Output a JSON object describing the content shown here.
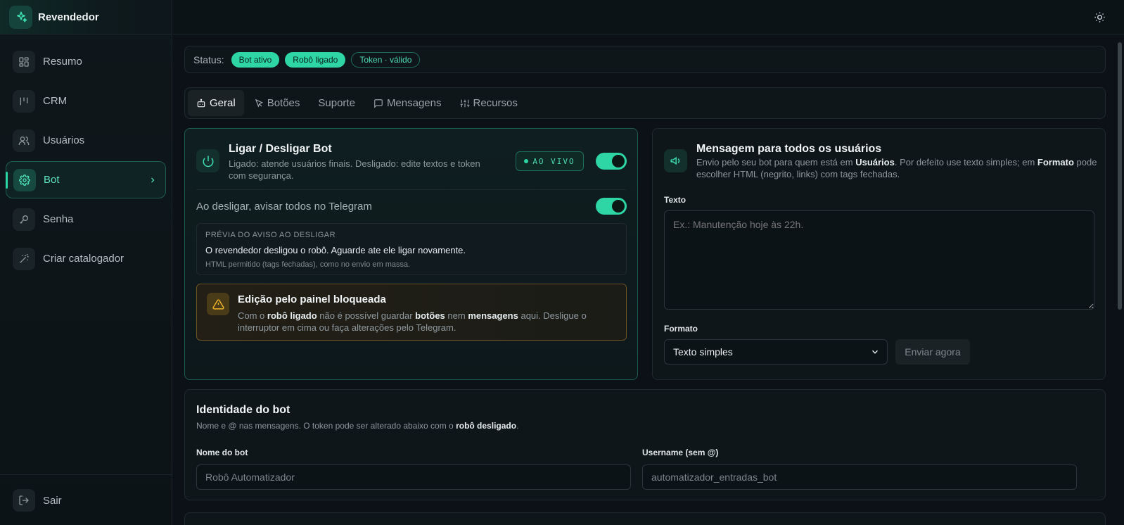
{
  "brand": {
    "name": "Revendedor"
  },
  "sidebar": {
    "items": [
      {
        "label": "Resumo",
        "icon": "dashboard-icon"
      },
      {
        "label": "CRM",
        "icon": "kanban-icon"
      },
      {
        "label": "Usuários",
        "icon": "users-icon"
      },
      {
        "label": "Bot",
        "icon": "gear-icon",
        "active": true
      },
      {
        "label": "Senha",
        "icon": "key-icon"
      },
      {
        "label": "Criar catalogador",
        "icon": "magic-wand-icon"
      }
    ],
    "logout": "Sair"
  },
  "status": {
    "label": "Status:",
    "pills": [
      "Bot ativo",
      "Robô ligado",
      "Token · válido"
    ]
  },
  "tabs": [
    {
      "label": "Geral",
      "icon": "robot-icon",
      "active": true
    },
    {
      "label": "Botões",
      "icon": "cursor-icon"
    },
    {
      "label": "Suporte",
      "icon": ""
    },
    {
      "label": "Mensagens",
      "icon": "chat-icon"
    },
    {
      "label": "Recursos",
      "icon": "sliders-icon"
    }
  ],
  "power_card": {
    "title": "Ligar / Desligar Bot",
    "desc_line1": "Ligado: atende usuários finais. Desligado: edite textos e token",
    "desc_line2": "com segurança.",
    "live_badge": "AO VIVO",
    "notify_label": "Ao desligar, avisar todos no Telegram",
    "preview": {
      "title": "PRÉVIA DO AVISO AO DESLIGAR",
      "message": "O revendedor desligou o robô. Aguarde ate ele ligar novamente.",
      "note": "HTML permitido (tags fechadas), como no envio em massa."
    },
    "warning": {
      "title": "Edição pelo painel bloqueada",
      "p1": "Com o ",
      "b1": "robô ligado",
      "p2": " não é possível guardar ",
      "b2": "botões",
      "p3": " nem ",
      "b3": "mensagens",
      "p4": " aqui. Desligue o interruptor em cima ou faça alterações pelo Telegram."
    }
  },
  "broadcast_card": {
    "title": "Mensagem para todos os usuários",
    "d1": "Envio pelo seu bot para quem está em ",
    "b1": "Usuários",
    "d2": ". Por defeito use texto simples; em ",
    "b2": "Formato",
    "d3": " pode escolher HTML (negrito, links) com tags fechadas.",
    "text_label": "Texto",
    "text_placeholder": "Ex.: Manutenção hoje às 22h.",
    "format_label": "Formato",
    "format_selected": "Texto simples",
    "send_label": "Enviar agora"
  },
  "identity_card": {
    "title": "Identidade do bot",
    "d1": "Nome e @ nas mensagens. O token pode ser alterado abaixo com o ",
    "b1": "robô desligado",
    "d2": ".",
    "name_label": "Nome do bot",
    "name_value": "Robô Automatizador",
    "username_label": "Username (sem @)",
    "username_value": "automatizador_entradas_bot"
  },
  "colors": {
    "accent": "#2fd6a5",
    "warning": "#f0b429",
    "background": "#0b1116"
  }
}
